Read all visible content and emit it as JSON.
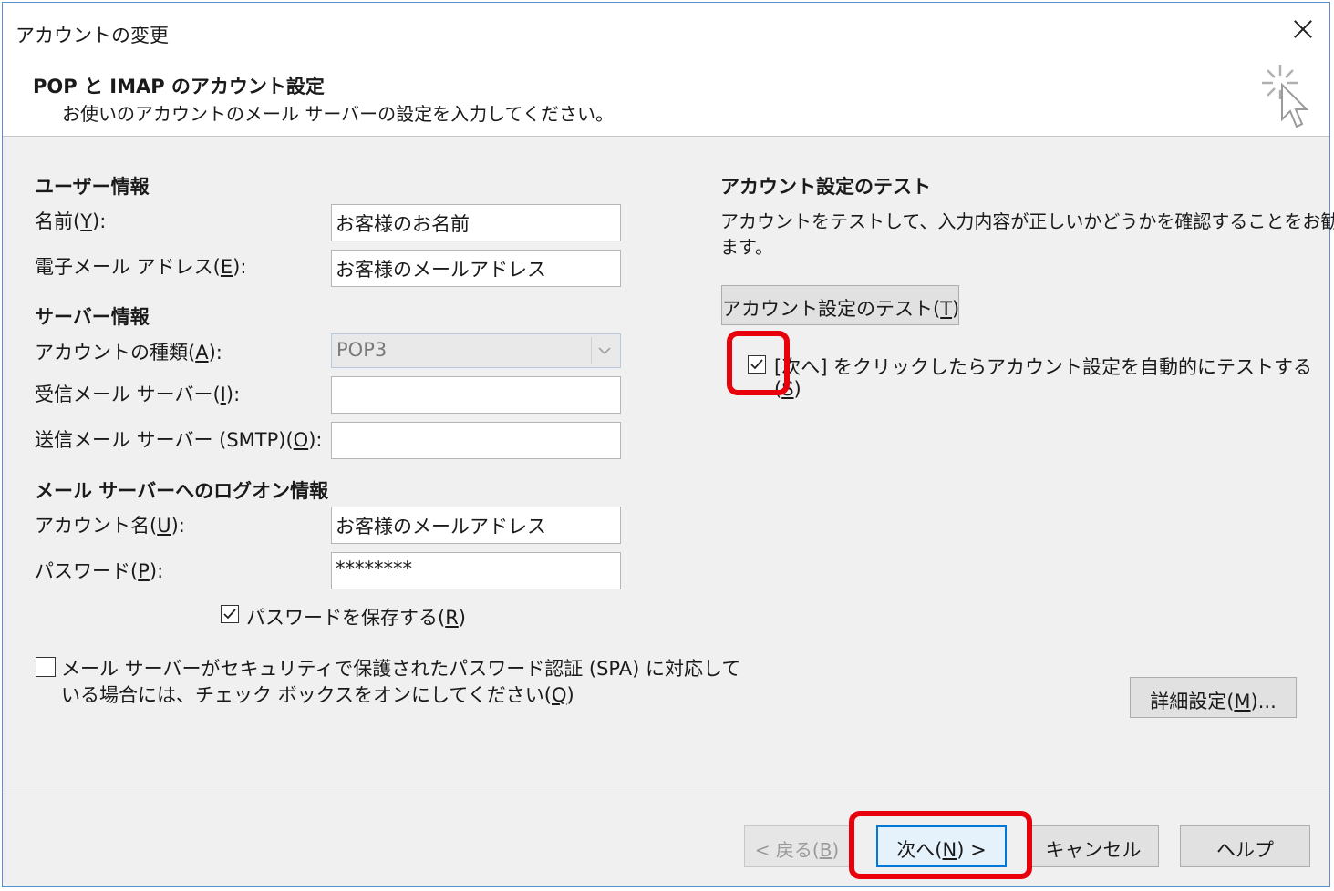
{
  "window": {
    "title": "アカウントの変更"
  },
  "header": {
    "title": "POP と IMAP のアカウント設定",
    "subtitle": "お使いのアカウントのメール サーバーの設定を入力してください。"
  },
  "user_info": {
    "heading": "ユーザー情報",
    "name_label_pre": "名前(",
    "name_label_key": "Y",
    "name_label_post": "):",
    "name_value": "お客様のお名前",
    "email_label_pre": "電子メール アドレス(",
    "email_label_key": "E",
    "email_label_post": "):",
    "email_value": "お客様のメールアドレス"
  },
  "server_info": {
    "heading": "サーバー情報",
    "type_label_pre": "アカウントの種類(",
    "type_label_key": "A",
    "type_label_post": "):",
    "type_value": "POP3",
    "incoming_label_pre": "受信メール サーバー(",
    "incoming_label_key": "I",
    "incoming_label_post": "):",
    "incoming_value": "",
    "outgoing_label_pre": "送信メール サーバー (SMTP)(",
    "outgoing_label_key": "O",
    "outgoing_label_post": "):",
    "outgoing_value": ""
  },
  "logon_info": {
    "heading": "メール サーバーへのログオン情報",
    "account_label_pre": "アカウント名(",
    "account_label_key": "U",
    "account_label_post": "):",
    "account_value": "お客様のメールアドレス",
    "password_label_pre": "パスワード(",
    "password_label_key": "P",
    "password_label_post": "):",
    "password_value": "********",
    "save_password_pre": "パスワードを保存する(",
    "save_password_key": "R",
    "save_password_post": ")",
    "save_password_checked": true
  },
  "spa": {
    "line1": "メール サーバーがセキュリティで保護されたパスワード認証 (SPA) に対応して",
    "line2_pre": "いる場合には、チェック ボックスをオンにしてください(",
    "line2_key": "Q",
    "line2_post": ")",
    "checked": false
  },
  "test": {
    "heading": "アカウント設定のテスト",
    "desc_line1": "アカウントをテストして、入力内容が正しいかどうかを確認することをお勧めし",
    "desc_line2": "ます。",
    "button_pre": "アカウント設定のテスト(",
    "button_key": "T",
    "button_post": ")",
    "auto_test_line1": "[次へ] をクリックしたらアカウント設定を自動的にテストする",
    "auto_test_line2_pre": "(",
    "auto_test_line2_key": "S",
    "auto_test_line2_post": ")",
    "auto_test_checked": true
  },
  "more_settings": {
    "pre": "詳細設定(",
    "key": "M",
    "post": ")..."
  },
  "footer": {
    "back_pre": "< 戻る(",
    "back_key": "B",
    "back_post": ")",
    "next_pre": "次へ(",
    "next_key": "N",
    "next_post": ") >",
    "cancel": "キャンセル",
    "help": "ヘルプ"
  },
  "colors": {
    "highlight": "#e8000b",
    "focus": "#0078d7"
  }
}
